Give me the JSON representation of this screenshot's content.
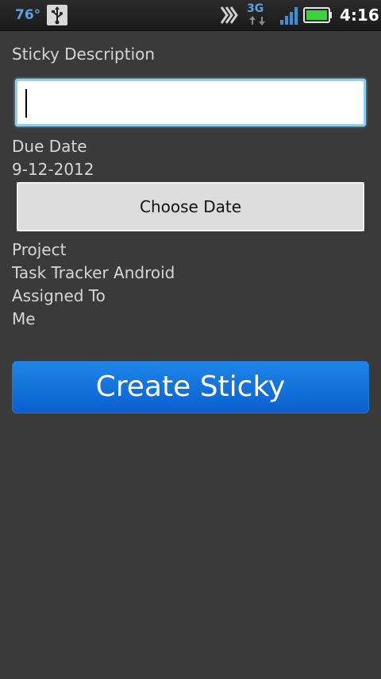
{
  "status_bar": {
    "temperature": "76°",
    "network_type": "3G",
    "time": "4:16",
    "accent_color": "#5fa0e0"
  },
  "form": {
    "description_label": "Sticky Description",
    "description_value": "",
    "due_date_label": "Due Date",
    "due_date_value": "9-12-2012",
    "choose_date_label": "Choose Date",
    "project_label": "Project",
    "project_value": "Task Tracker Android",
    "assigned_label": "Assigned To",
    "assigned_value": "Me",
    "create_label": "Create Sticky",
    "create_color": "#0a6ad8"
  }
}
